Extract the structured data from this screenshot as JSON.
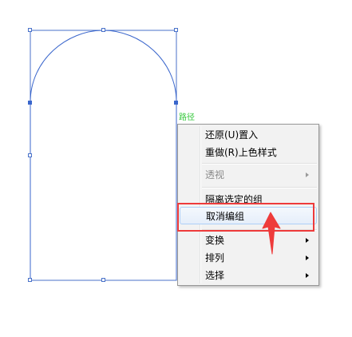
{
  "canvas": {
    "path_label": "路径",
    "shape_color": "#3a66cc",
    "selection_color": "#4a72c9"
  },
  "context_menu": {
    "items": [
      {
        "label": "还原(U)置入",
        "enabled": true,
        "submenu": false
      },
      {
        "label": "重做(R)上色样式",
        "enabled": true,
        "submenu": false
      },
      {
        "label": "透视",
        "enabled": false,
        "submenu": true
      },
      {
        "label": "隔离选定的组",
        "enabled": true,
        "submenu": false
      },
      {
        "label": "取消编组",
        "enabled": true,
        "submenu": false,
        "highlighted": true
      },
      {
        "label": "变换",
        "enabled": true,
        "submenu": true
      },
      {
        "label": "排列",
        "enabled": true,
        "submenu": true
      },
      {
        "label": "选择",
        "enabled": true,
        "submenu": true
      }
    ]
  },
  "annotation": {
    "box_color": "#ee3b3b",
    "arrow_color": "#ee3b3b",
    "arrow_icon": "up-arrow-icon"
  }
}
